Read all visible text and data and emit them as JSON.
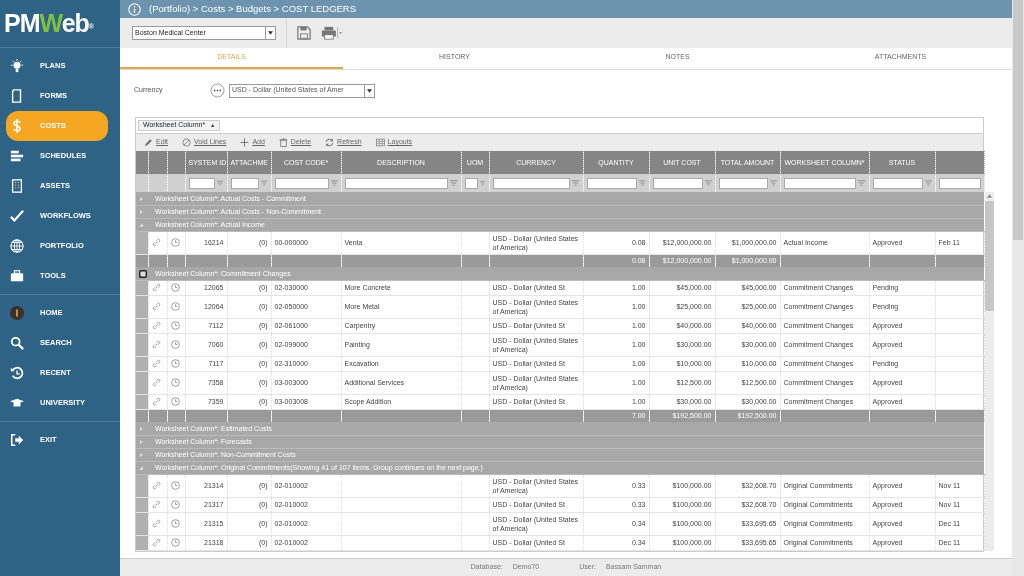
{
  "logo": {
    "text": "PMWeb",
    "mark": "®"
  },
  "sidebar": {
    "sections": [
      {
        "items": [
          {
            "label": "PLANS",
            "selected": false
          },
          {
            "label": "FORMS",
            "selected": false
          },
          {
            "label": "COSTS",
            "selected": true
          },
          {
            "label": "SCHEDULES",
            "selected": false
          },
          {
            "label": "ASSETS",
            "selected": false
          },
          {
            "label": "WORKFLOWS",
            "selected": false
          },
          {
            "label": "PORTFOLIO",
            "selected": false
          },
          {
            "label": "TOOLS",
            "selected": false
          }
        ]
      },
      {
        "items": [
          {
            "label": "HOME",
            "selected": false
          },
          {
            "label": "SEARCH",
            "selected": false
          },
          {
            "label": "RECENT",
            "selected": false
          },
          {
            "label": "UNIVERSITY",
            "selected": false
          }
        ]
      },
      {
        "items": [
          {
            "label": "EXIT",
            "selected": false
          }
        ]
      }
    ]
  },
  "breadcrumb": {
    "link": "(Portfolio)",
    "path": " > Costs > Budgets > COST LEDGERS"
  },
  "project_select": {
    "value": "Boston Medical Center"
  },
  "tabs": [
    {
      "label": "DETAILS",
      "selected": true
    },
    {
      "label": "HISTORY",
      "selected": false
    },
    {
      "label": "NOTES",
      "selected": false
    },
    {
      "label": "ATTACHMENTS",
      "selected": false
    }
  ],
  "currency": {
    "label": "Currency",
    "value": "USD - Dollar (United States of Amer"
  },
  "grouping_chip": {
    "label": "Worksheet Column*",
    "sort": "▲"
  },
  "grid_toolbar": [
    "Edit",
    "Void Lines",
    "Add",
    "Delete",
    "Refresh",
    "Layouts"
  ],
  "table": {
    "columns": [
      "SYSTEM ID",
      "ATTACHME",
      "COST CODE*",
      "DESCRIPTION",
      "UOM",
      "CURRENCY",
      "QUANTITY",
      "UNIT COST",
      "TOTAL AMOUNT",
      "WORKSHEET COLUMN*",
      "STATUS"
    ],
    "groups": [
      {
        "label": "Worksheet Column*: Actual Costs - Commitment",
        "expanded": false,
        "focused": false
      },
      {
        "label": "Worksheet Column*: Actual Costs - Non-Commitment",
        "expanded": false,
        "focused": false
      },
      {
        "label": "Worksheet Column*: Actual Income",
        "expanded": true,
        "focused": false,
        "rows": [
          {
            "system_id": "16214",
            "attachments": "(0)",
            "cost_code": "00-000000",
            "description": "Venta",
            "currency": "USD - Dollar (United States of America)",
            "quantity": "0.08",
            "unit_cost": "$12,000,000.00",
            "total_amount": "$1,000,000.00",
            "worksheet_column": "Actual Income",
            "status": "Approved",
            "column_15": "Feb 11"
          }
        ],
        "totals": {
          "quantity": "0.08",
          "unit_cost": "$12,000,000.00",
          "total_amount": "$1,000,000.00"
        }
      },
      {
        "label": "Worksheet Column*: Commitment Changes",
        "expanded": true,
        "focused": true,
        "rows": [
          {
            "system_id": "12065",
            "attachments": "(0)",
            "cost_code": "02-030000",
            "description": "More Concrete",
            "currency": "USD - Dollar (United St",
            "quantity": "1.00",
            "unit_cost": "$45,000.00",
            "total_amount": "$45,000.00",
            "worksheet_column": "Commitment Changes",
            "status": "Pending"
          },
          {
            "system_id": "12064",
            "attachments": "(0)",
            "cost_code": "02-050000",
            "description": "More Metal",
            "currency": "USD - Dollar (United States of America)",
            "quantity": "1.00",
            "unit_cost": "$25,000.00",
            "total_amount": "$25,000.00",
            "worksheet_column": "Commitment Changes",
            "status": "Pending"
          },
          {
            "system_id": "7112",
            "attachments": "(0)",
            "cost_code": "02-061000",
            "description": "Carpentry",
            "currency": "USD - Dollar (United St",
            "quantity": "1.00",
            "unit_cost": "$40,000.00",
            "total_amount": "$40,000.00",
            "worksheet_column": "Commitment Changes",
            "status": "Approved"
          },
          {
            "system_id": "7060",
            "attachments": "(0)",
            "cost_code": "02-099000",
            "description": "Painting",
            "currency": "USD - Dollar (United States of America)",
            "quantity": "1.00",
            "unit_cost": "$30,000.00",
            "total_amount": "$30,000.00",
            "worksheet_column": "Commitment Changes",
            "status": "Approved"
          },
          {
            "system_id": "7117",
            "attachments": "(0)",
            "cost_code": "02-310000",
            "description": "Excavation",
            "currency": "USD - Dollar (United St",
            "quantity": "1.00",
            "unit_cost": "$10,000.00",
            "total_amount": "$10,000.00",
            "worksheet_column": "Commitment Changes",
            "status": "Pending"
          },
          {
            "system_id": "7358",
            "attachments": "(0)",
            "cost_code": "03-003000",
            "description": "Additional Services",
            "currency": "USD - Dollar (United States of America)",
            "quantity": "1.00",
            "unit_cost": "$12,500.00",
            "total_amount": "$12,500.00",
            "worksheet_column": "Commitment Changes",
            "status": "Approved"
          },
          {
            "system_id": "7359",
            "attachments": "(0)",
            "cost_code": "03-003008",
            "description": "Scope Addition",
            "currency": "USD - Dollar (United St",
            "quantity": "1.00",
            "unit_cost": "$30,000.00",
            "total_amount": "$30,000.00",
            "worksheet_column": "Commitment Changes",
            "status": "Approved"
          }
        ],
        "totals": {
          "quantity": "7.00",
          "unit_cost": "$192,500.00",
          "total_amount": "$192,500.00"
        }
      },
      {
        "label": "Worksheet Column*: Estimated Costs",
        "expanded": false,
        "focused": false
      },
      {
        "label": "Worksheet Column*: Forecasts",
        "expanded": false,
        "focused": false
      },
      {
        "label": "Worksheet Column*: Non-Commitment Costs",
        "expanded": false,
        "focused": false
      },
      {
        "label": "Worksheet Column*: Original Commitments(Showing 41 of 107 items. Group continues on the next page.)",
        "expanded": true,
        "focused": false,
        "rows": [
          {
            "system_id": "21314",
            "attachments": "(0)",
            "cost_code": "02-010002",
            "currency": "USD - Dollar (United States of America)",
            "quantity": "0.33",
            "unit_cost": "$100,000.00",
            "total_amount": "$32,608.70",
            "worksheet_column": "Original Commitments",
            "status": "Approved",
            "column_15": "Nov 11"
          },
          {
            "system_id": "21317",
            "attachments": "(0)",
            "cost_code": "02-010002",
            "currency": "USD - Dollar (United St",
            "quantity": "0.33",
            "unit_cost": "$100,000.00",
            "total_amount": "$32,608.70",
            "worksheet_column": "Original Commitments",
            "status": "Approved",
            "column_15": "Nov 11"
          },
          {
            "system_id": "21315",
            "attachments": "(0)",
            "cost_code": "02-010002",
            "currency": "USD - Dollar (United States of America)",
            "quantity": "0.34",
            "unit_cost": "$100,000.00",
            "total_amount": "$33,695.65",
            "worksheet_column": "Original Commitments",
            "status": "Approved",
            "column_15": "Dec 11"
          },
          {
            "system_id": "21318",
            "attachments": "(0)",
            "cost_code": "02-010002",
            "currency": "USD - Dollar (United St",
            "quantity": "0.34",
            "unit_cost": "$100,000.00",
            "total_amount": "$33,695.65",
            "worksheet_column": "Original Commitments",
            "status": "Approved",
            "column_15": "Dec 11"
          }
        ]
      }
    ]
  },
  "status_bar": {
    "database_label": "Database:",
    "database": "Demo70",
    "user_label": "User:",
    "user": "Bassam Samman"
  }
}
